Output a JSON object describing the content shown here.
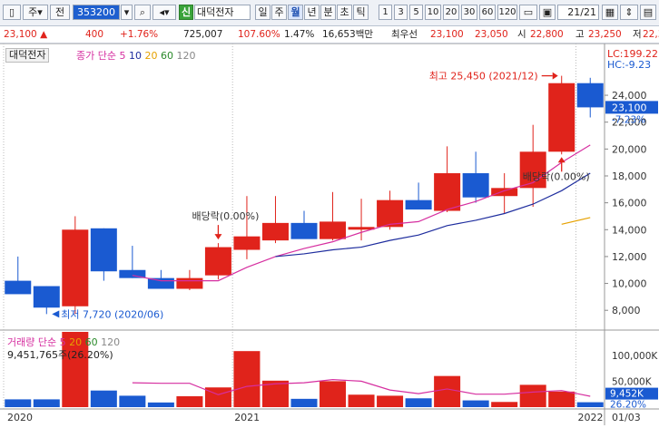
{
  "toolbar": {
    "market": "주",
    "type": "전",
    "code": "353200",
    "badge": "신",
    "name": "대덕전자",
    "periods": [
      "일",
      "주",
      "월",
      "년",
      "분",
      "초",
      "틱"
    ],
    "selected_period": "월",
    "intervals": [
      "1",
      "3",
      "5",
      "10",
      "20",
      "30",
      "60",
      "120"
    ],
    "count": "21",
    "count_total": "/21"
  },
  "quote": {
    "price": "23,100",
    "change": "400",
    "change_pct": "+1.76%",
    "volume": "725,007",
    "vol_ratio": "107.60%",
    "turnover": "1.47%",
    "amount": "16,653백만",
    "prio_label": "최우선",
    "ask": "23,100",
    "bid": "23,050",
    "open_label": "시",
    "open": "22,800",
    "high_label": "고",
    "high": "23,250",
    "low_label": "저",
    "low": "22,350"
  },
  "price_panel": {
    "stock_name": "대덕전자",
    "ma_label": "종가 단순",
    "ma_periods": [
      "5",
      "10",
      "20",
      "60",
      "120"
    ],
    "lc": "LC:199.22",
    "hc": "HC:-9.23",
    "current_price": "23,100",
    "current_pct": "-7.23%",
    "high_marker": "최고 25,450 (2021/12)",
    "low_marker": "최저 7,720 (2020/06)",
    "div1": "배당락(0.00%)",
    "div2": "배당락(0.00%)"
  },
  "volume_panel": {
    "label": "거래량",
    "ma_label": "단순",
    "ma_periods": [
      "5",
      "20",
      "60",
      "120"
    ],
    "value": "9,451,765주(26.20%)",
    "current_vol": "9,452K",
    "current_pct": "26.20%"
  },
  "x_labels": [
    "2020",
    "2021",
    "2022",
    "01/03"
  ],
  "colors": {
    "up": "#e0231b",
    "down": "#1a5ad1",
    "ma5": "#d62fa0",
    "ma10": "#1e2d9e",
    "ma20": "#e6a100",
    "ma60": "#2a8a2a",
    "ma120": "#888888"
  },
  "chart_data": {
    "type": "candlestick",
    "period": "monthly",
    "y_ticks": [
      8000,
      10000,
      12000,
      14000,
      16000,
      18000,
      20000,
      22000,
      24000
    ],
    "ylim": [
      6800,
      26500
    ],
    "candles": [
      {
        "o": 10200,
        "h": 12000,
        "l": 9600,
        "c": 9200
      },
      {
        "o": 9800,
        "h": 9800,
        "l": 7720,
        "c": 8200
      },
      {
        "o": 8300,
        "h": 15000,
        "l": 7720,
        "c": 14000
      },
      {
        "o": 14100,
        "h": 14100,
        "l": 10200,
        "c": 10900
      },
      {
        "o": 11000,
        "h": 12800,
        "l": 10400,
        "c": 10400
      },
      {
        "o": 10400,
        "h": 11000,
        "l": 9800,
        "c": 9600
      },
      {
        "o": 9600,
        "h": 11000,
        "l": 9500,
        "c": 10400
      },
      {
        "o": 10600,
        "h": 13000,
        "l": 10300,
        "c": 12700
      },
      {
        "o": 12500,
        "h": 16500,
        "l": 11800,
        "c": 13500
      },
      {
        "o": 13200,
        "h": 16500,
        "l": 13000,
        "c": 14500
      },
      {
        "o": 14500,
        "h": 15400,
        "l": 13400,
        "c": 13300
      },
      {
        "o": 13300,
        "h": 16800,
        "l": 13200,
        "c": 14600
      },
      {
        "o": 14000,
        "h": 16300,
        "l": 13200,
        "c": 14200
      },
      {
        "o": 14200,
        "h": 16900,
        "l": 14000,
        "c": 16200
      },
      {
        "o": 16200,
        "h": 17500,
        "l": 15600,
        "c": 15500
      },
      {
        "o": 15400,
        "h": 20200,
        "l": 15300,
        "c": 18200
      },
      {
        "o": 18200,
        "h": 19800,
        "l": 16000,
        "c": 16400
      },
      {
        "o": 16500,
        "h": 18200,
        "l": 15200,
        "c": 17100
      },
      {
        "o": 17100,
        "h": 21800,
        "l": 15700,
        "c": 19800
      },
      {
        "o": 19800,
        "h": 25450,
        "l": 19600,
        "c": 24900
      },
      {
        "o": 24900,
        "h": 25300,
        "l": 22350,
        "c": 23100
      }
    ],
    "ma5": [
      null,
      null,
      null,
      null,
      10600,
      10200,
      10200,
      10200,
      11200,
      12000,
      12600,
      13100,
      13800,
      14400,
      14600,
      15500,
      16100,
      16900,
      17500,
      19000,
      20300
    ],
    "ma10": [
      null,
      null,
      null,
      null,
      null,
      null,
      null,
      null,
      null,
      12000,
      12200,
      12500,
      12700,
      13200,
      13600,
      14300,
      14700,
      15200,
      15900,
      16900,
      18200
    ],
    "ma20": [
      null,
      null,
      null,
      null,
      null,
      null,
      null,
      null,
      null,
      null,
      null,
      null,
      null,
      null,
      null,
      null,
      null,
      null,
      null,
      14400,
      14900
    ],
    "volume_ylim": [
      0,
      145000000
    ],
    "volume": [
      15000000,
      15000000,
      150000000,
      32000000,
      22000000,
      9000000,
      21000000,
      38000000,
      108000000,
      51000000,
      16000000,
      50000000,
      24000000,
      22000000,
      17000000,
      60000000,
      13000000,
      10000000,
      43000000,
      30000000,
      9452000
    ],
    "volume_ma5": [
      null,
      null,
      null,
      null,
      47000000,
      46000000,
      46000000,
      24000000,
      40000000,
      45000000,
      47000000,
      53000000,
      50000000,
      33000000,
      26000000,
      35000000,
      25000000,
      25000000,
      29000000,
      32000000,
      21000000
    ],
    "volume_ticks": [
      "100,000K",
      "50,000K"
    ]
  }
}
